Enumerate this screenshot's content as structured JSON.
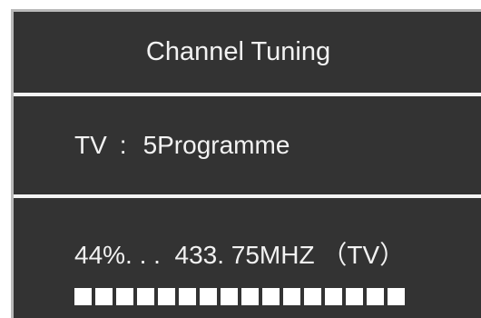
{
  "dialog": {
    "title": "Channel Tuning",
    "source_label": "TV",
    "source_separator": ":",
    "source_value": "5Programme",
    "progress_text": "44%. . .  433. 75MHZ （TV）",
    "progress_percent": 44,
    "progress_blocks": 16
  },
  "colors": {
    "panel_background": "#333333",
    "text": "#f2f2f2",
    "divider": "#f4f4f4",
    "progress_block": "#ffffff"
  }
}
